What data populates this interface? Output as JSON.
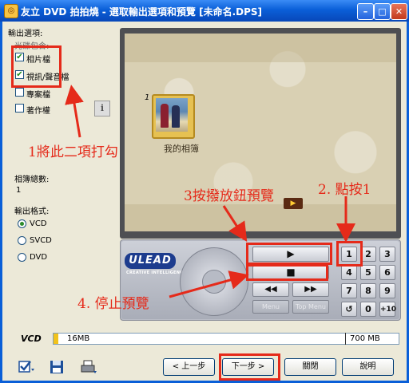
{
  "window": {
    "title": "友立 DVD 拍拍燒 - 選取輸出選項和預覽 [未命名.DPS]",
    "controls": [
      "minimize",
      "maximize",
      "close"
    ]
  },
  "options": {
    "heading": "輸出選項:",
    "include_heading": "光碟包含:",
    "checkboxes": [
      {
        "label": "相片檔",
        "checked": true
      },
      {
        "label": "視訊/聲音檔",
        "checked": true
      },
      {
        "label": "專案檔",
        "checked": false
      },
      {
        "label": "著作權",
        "checked": false
      }
    ],
    "album_count_label": "相簿總數:",
    "album_count": "1",
    "format_label": "輸出格式:",
    "formats": [
      {
        "label": "VCD",
        "selected": true
      },
      {
        "label": "SVCD",
        "selected": false
      },
      {
        "label": "DVD",
        "selected": false
      }
    ]
  },
  "preview": {
    "album_caption": "我的相簿",
    "page_marker": "1"
  },
  "controls": {
    "logo": "ULEAD",
    "logo_tagline": "CREATIVE INTELLIGENCE",
    "play": "▶",
    "stop": "■",
    "rewind": "◀◀",
    "forward": "▶▶",
    "menu": "Menu",
    "top_menu": "Top Menu",
    "keys": [
      "1",
      "2",
      "3",
      "4",
      "5",
      "6",
      "7",
      "8",
      "9",
      "↺",
      "0",
      "+10"
    ]
  },
  "disc": {
    "type": "VCD",
    "used": "16MB",
    "capacity": "700 MB",
    "used_fraction": 0.023
  },
  "buttons": {
    "back": "< 上一步",
    "next": "下一步 >",
    "close": "關閉",
    "help": "說明"
  },
  "annotations": {
    "a1": "1將此二項打勾",
    "a2": "2. 點按1",
    "a3": "3按撥放鈕預覽",
    "a4": "4. 停止預覽"
  },
  "colors": {
    "annotation": "#e52a1a",
    "titlebar": "#0a5fd8"
  }
}
